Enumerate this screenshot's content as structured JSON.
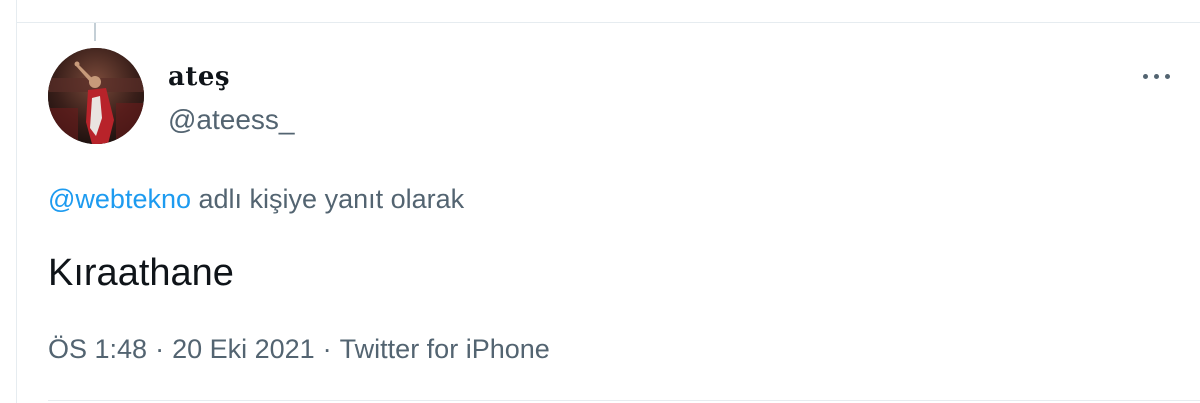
{
  "tweet": {
    "display_name": "ateş",
    "handle": "@ateess_",
    "reply_mention": "@webtekno",
    "reply_suffix": "adlı kişiye yanıt olarak",
    "text": "Kıraathane",
    "time": "ÖS 1:48",
    "date": "20 Eki 2021",
    "source": "Twitter for iPhone",
    "separator": "·"
  },
  "icons": {
    "more": "more-horizontal-icon",
    "avatar": "profile-photo"
  },
  "colors": {
    "link": "#1d9bf0",
    "secondary_text": "#536471",
    "primary_text": "#0f1419",
    "divider": "#e6ecf0"
  }
}
